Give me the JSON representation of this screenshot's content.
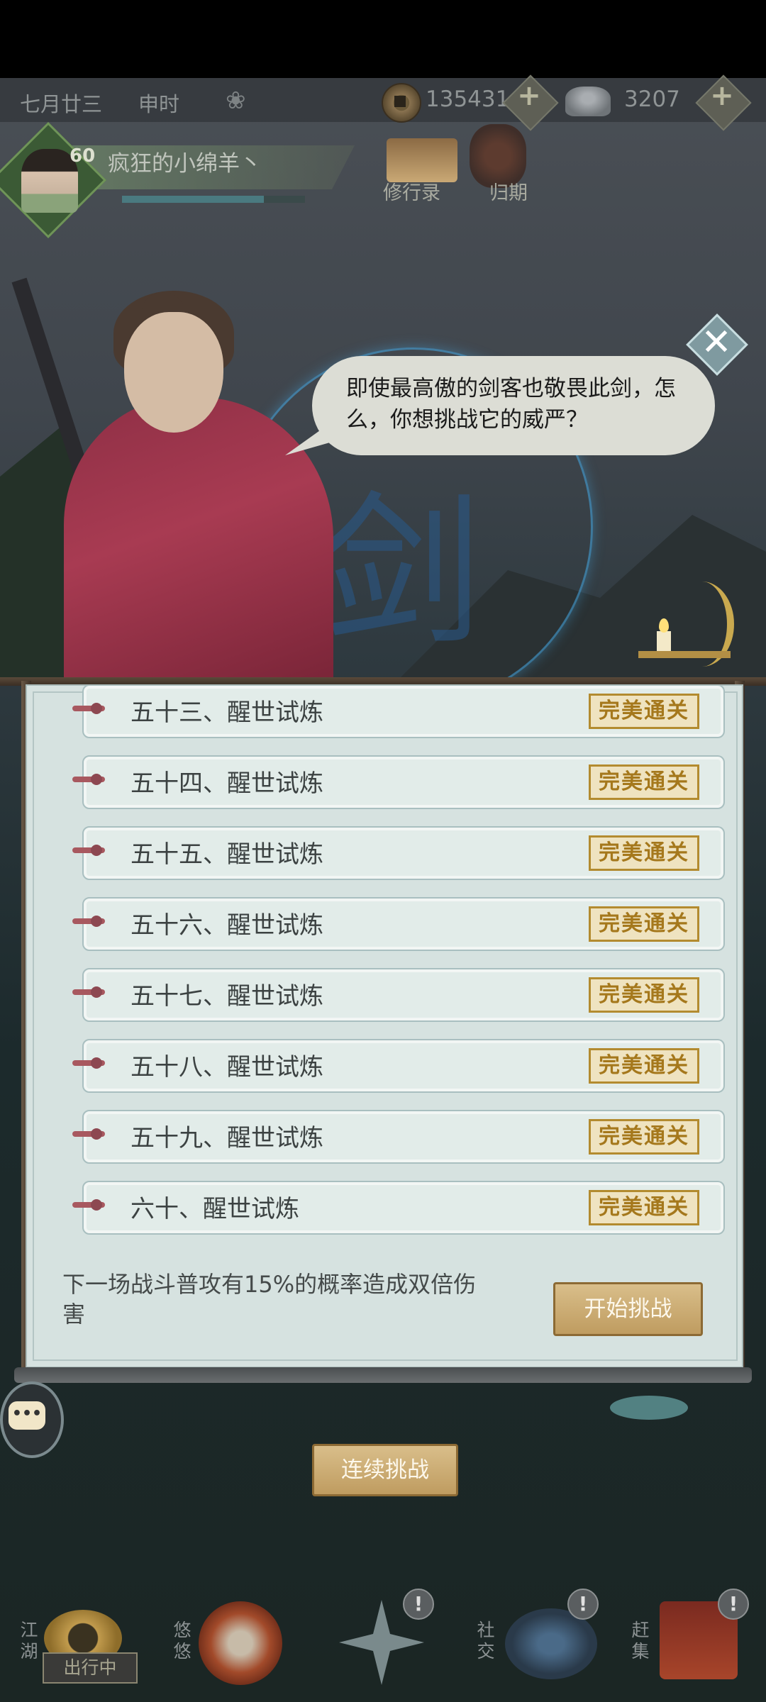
{
  "topbar": {
    "date": "七月廿三",
    "time": "申时",
    "copper_value": "135431",
    "silver_value": "3207",
    "plus": "+"
  },
  "profile": {
    "level": "60",
    "name": "疯狂的小绵羊丶"
  },
  "shortcuts": {
    "journal_label": "修行录",
    "return_label": "归期"
  },
  "dialog": {
    "text": "即使最高傲的剑客也敬畏此剑，怎么，你想挑战它的威严？"
  },
  "glyph": "剑",
  "close": "✕",
  "stages": [
    {
      "label": "五十三、醒世试炼",
      "status": "完美通关"
    },
    {
      "label": "五十四、醒世试炼",
      "status": "完美通关"
    },
    {
      "label": "五十五、醒世试炼",
      "status": "完美通关"
    },
    {
      "label": "五十六、醒世试炼",
      "status": "完美通关"
    },
    {
      "label": "五十七、醒世试炼",
      "status": "完美通关"
    },
    {
      "label": "五十八、醒世试炼",
      "status": "完美通关"
    },
    {
      "label": "五十九、醒世试炼",
      "status": "完美通关"
    },
    {
      "label": "六十、醒世试炼",
      "status": "完美通关"
    }
  ],
  "panel": {
    "description": "下一场战斗普攻有15%的概率造成双倍伤害",
    "start_button": "开始挑战"
  },
  "continuous_button": "连续挑战",
  "chat_icon_text": "•••",
  "bottom_nav": {
    "jianghu": "江湖",
    "youyou": "悠悠",
    "shejiao": "社交",
    "ganji": "赶集",
    "out_badge": "出行中",
    "excl": "!"
  }
}
